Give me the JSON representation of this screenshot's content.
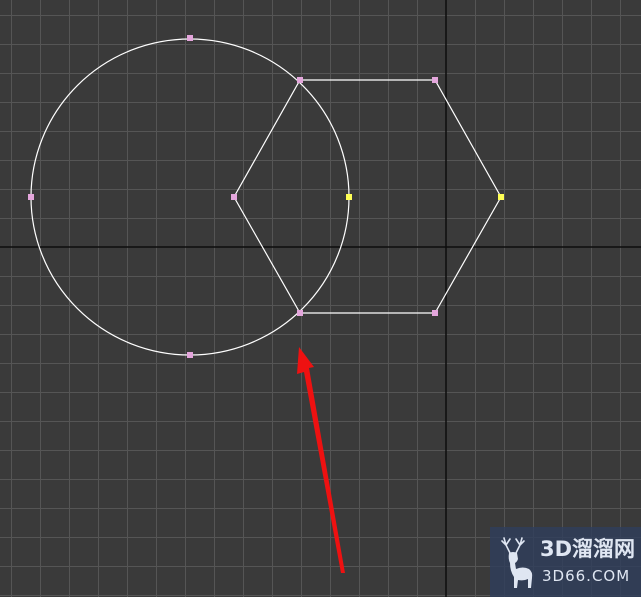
{
  "colors": {
    "background": "#3a3a3a",
    "grid": "#555555",
    "axis": "#0d0d0d",
    "shape_stroke": "#ffffff",
    "vertex": "#e4a6dc",
    "vertex_selected": "#ffff55",
    "arrow": "#ee1111",
    "watermark_text": "#dfe6f2"
  },
  "icons": {
    "viewport_grid": "grid-icon",
    "arrow": "red-arrow-annotation-icon",
    "logo": "deer-logo-icon"
  },
  "watermark": {
    "title": "3D溜溜网",
    "subtitle": "3D66.COM"
  }
}
